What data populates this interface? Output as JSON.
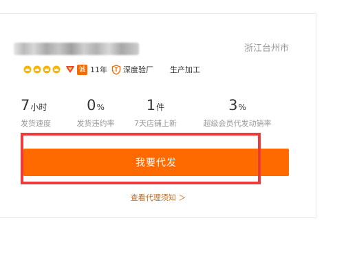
{
  "supplier": {
    "name_redacted": "",
    "location": "浙江台州市"
  },
  "badges": {
    "crown_icons": [
      "crown-icon",
      "crown-icon",
      "crown-icon",
      "crown-icon"
    ],
    "years": "11年",
    "verification": "深度验厂",
    "business_type": "生产加工",
    "cheng_label": "诚"
  },
  "stats": [
    {
      "value": "7",
      "unit": "小时",
      "label": "发货速度"
    },
    {
      "value": "0",
      "unit": "%",
      "label": "发货违约率"
    },
    {
      "value": "1",
      "unit": "件",
      "label": "7天店铺上新"
    },
    {
      "value": "3",
      "unit": "%",
      "label": "超级会员代发动销率"
    }
  ],
  "cta": {
    "label": "我要代发"
  },
  "link": {
    "label": "查看代理须知 ＞"
  },
  "colors": {
    "accent": "#ff6a00",
    "highlight_border": "#ee3a3a",
    "muted_text": "#999999",
    "link_text": "#c0691e"
  }
}
